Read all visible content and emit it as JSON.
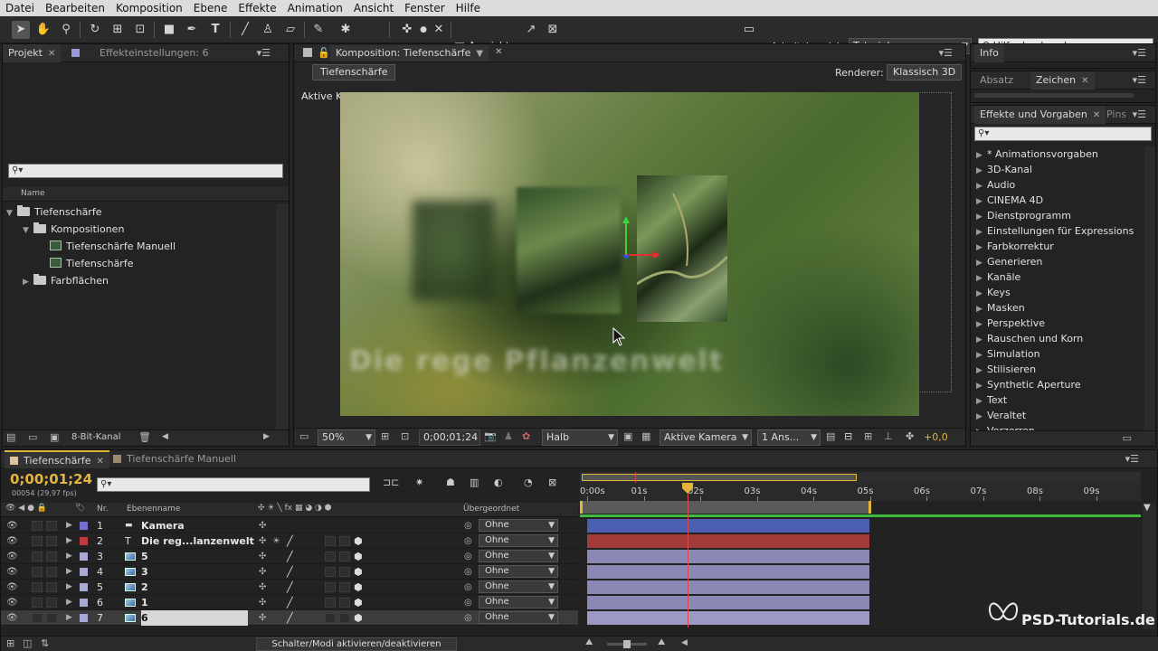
{
  "menu": [
    "Datei",
    "Bearbeiten",
    "Komposition",
    "Ebene",
    "Effekte",
    "Animation",
    "Ansicht",
    "Fenster",
    "Hilfe"
  ],
  "toolbar": {
    "align_label": "Ausrichten",
    "workspace_label": "Arbeitsbereich:",
    "workspace_value": "Tutorials",
    "help_search": "Hilfe durchsuchen"
  },
  "project_panel": {
    "tab_project": "Projekt",
    "tab_effects_settings": "Effekteinstellungen: 6",
    "col_name": "Name",
    "bit_depth": "8-Bit-Kanal",
    "tree": [
      {
        "label": "Tiefenschärfe",
        "type": "folder",
        "indent": 0,
        "expanded": true
      },
      {
        "label": "Kompositionen",
        "type": "folder",
        "indent": 1,
        "expanded": true
      },
      {
        "label": "Tiefenschärfe Manuell",
        "type": "comp",
        "indent": 2
      },
      {
        "label": "Tiefenschärfe",
        "type": "comp",
        "indent": 2
      },
      {
        "label": "Farbflächen",
        "type": "folder",
        "indent": 1,
        "expanded": false
      }
    ]
  },
  "composition_panel": {
    "tab": "Komposition: Tiefenschärfe",
    "subtab": "Tiefenschärfe",
    "renderer_label": "Renderer:",
    "renderer_value": "Klassisch 3D",
    "view_label": "Aktive Kamera",
    "footer": {
      "zoom": "50%",
      "timecode": "0;00;01;24",
      "resolution": "Halb",
      "camera": "Aktive Kamera",
      "views": "1 Ans...",
      "exposure": "+0,0"
    }
  },
  "right_panels": {
    "info_tab": "Info",
    "absatz_tab": "Absatz",
    "zeichen_tab": "Zeichen",
    "effects_tab": "Effekte und Vorgaben",
    "pinsel_tab": "Pins",
    "effects_list": [
      "* Animationsvorgaben",
      "3D-Kanal",
      "Audio",
      "CINEMA 4D",
      "Dienstprogramm",
      "Einstellungen für Expressions",
      "Farbkorrektur",
      "Generieren",
      "Kanäle",
      "Keys",
      "Masken",
      "Perspektive",
      "Rauschen und Korn",
      "Simulation",
      "Stilisieren",
      "Synthetic Aperture",
      "Text",
      "Veraltet",
      "Verzerren"
    ]
  },
  "timeline": {
    "tab_active": "Tiefenschärfe",
    "tab_other": "Tiefenschärfe Manuell",
    "timecode": "0;00;01;24",
    "frames": "00054 (29,97 fps)",
    "col_nr": "Nr.",
    "col_name": "Ebenenname",
    "col_parent": "Übergeordnet",
    "ruler": [
      "0:00s",
      "01s",
      "02s",
      "03s",
      "04s",
      "05s",
      "06s",
      "07s",
      "08s",
      "09s"
    ],
    "toggle_label": "Schalter/Modi aktivieren/deaktivieren",
    "layers": [
      {
        "nr": "1",
        "name": "Kamera",
        "type": "camera",
        "color": "#6f6fd6",
        "bar": "#4c5fb0",
        "parent": "Ohne"
      },
      {
        "nr": "2",
        "name": "Die reg...lanzenwelt",
        "type": "text",
        "color": "#c0393b",
        "bar": "#a23a3a",
        "parent": "Ohne"
      },
      {
        "nr": "3",
        "name": "5",
        "type": "image",
        "color": "#a9a9d6",
        "bar": "#8a88b4",
        "parent": "Ohne"
      },
      {
        "nr": "4",
        "name": "3",
        "type": "image",
        "color": "#a9a9d6",
        "bar": "#8a88b4",
        "parent": "Ohne"
      },
      {
        "nr": "5",
        "name": "2",
        "type": "image",
        "color": "#a9a9d6",
        "bar": "#8a88b4",
        "parent": "Ohne"
      },
      {
        "nr": "6",
        "name": "1",
        "type": "image",
        "color": "#a9a9d6",
        "bar": "#8a88b4",
        "parent": "Ohne"
      },
      {
        "nr": "7",
        "name": "6",
        "type": "image",
        "color": "#a9a9d6",
        "bar": "#9c9ac4",
        "parent": "Ohne",
        "selected": true
      }
    ]
  },
  "watermark": "PSD-Tutorials.de",
  "colors": {
    "accent_timecode": "#e3b53c",
    "playhead": "#d94a4a",
    "work_area": "#3dbb3d"
  }
}
